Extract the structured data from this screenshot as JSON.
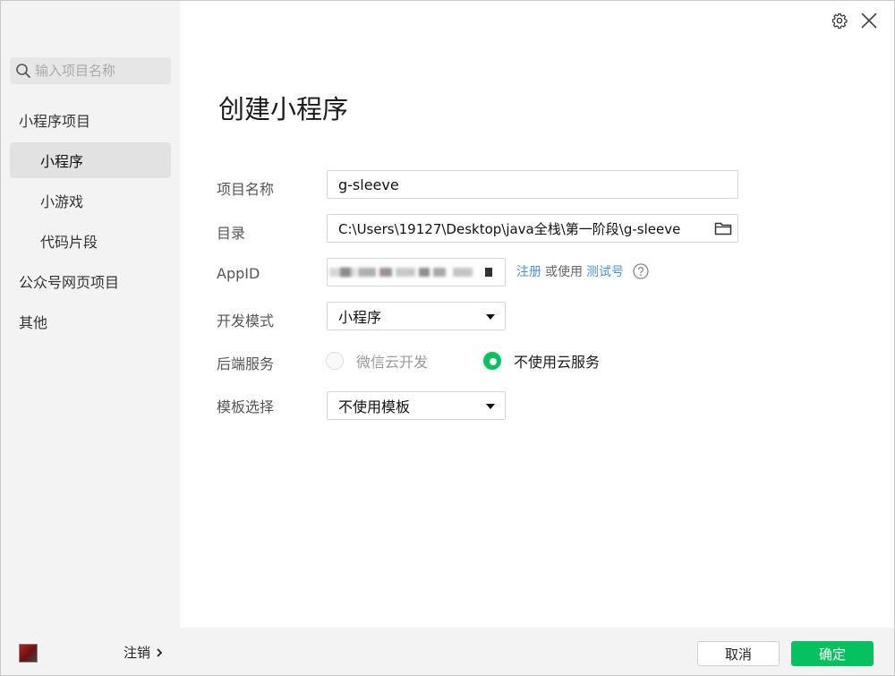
{
  "sidebar": {
    "search_placeholder": "输入项目名称",
    "items": [
      {
        "label": "小程序项目"
      },
      {
        "label": "小程序"
      },
      {
        "label": "小游戏"
      },
      {
        "label": "代码片段"
      },
      {
        "label": "公众号网页项目"
      },
      {
        "label": "其他"
      }
    ],
    "logout_label": "注销"
  },
  "main": {
    "title": "创建小程序",
    "form": {
      "project_name_label": "项目名称",
      "project_name_value": "g-sleeve",
      "directory_label": "目录",
      "directory_value": "C:\\Users\\19127\\Desktop\\java全栈\\第一阶段\\g-sleeve",
      "appid_label": "AppID",
      "register_link": "注册",
      "or_use_text": "或使用",
      "test_account_link": "测试号",
      "dev_mode_label": "开发模式",
      "dev_mode_value": "小程序",
      "backend_label": "后端服务",
      "backend_option_cloud": "微信云开发",
      "backend_option_none": "不使用云服务",
      "template_label": "模板选择",
      "template_value": "不使用模板"
    },
    "buttons": {
      "cancel": "取消",
      "confirm": "确定"
    }
  },
  "colors": {
    "accent_green": "#07c160",
    "link_blue": "#4a90e2",
    "sidebar_bg": "#f3f3f3"
  },
  "icons": [
    "search-icon",
    "gear-icon",
    "close-icon",
    "folder-icon",
    "help-icon",
    "chevron-right-icon",
    "caret-down-icon"
  ]
}
